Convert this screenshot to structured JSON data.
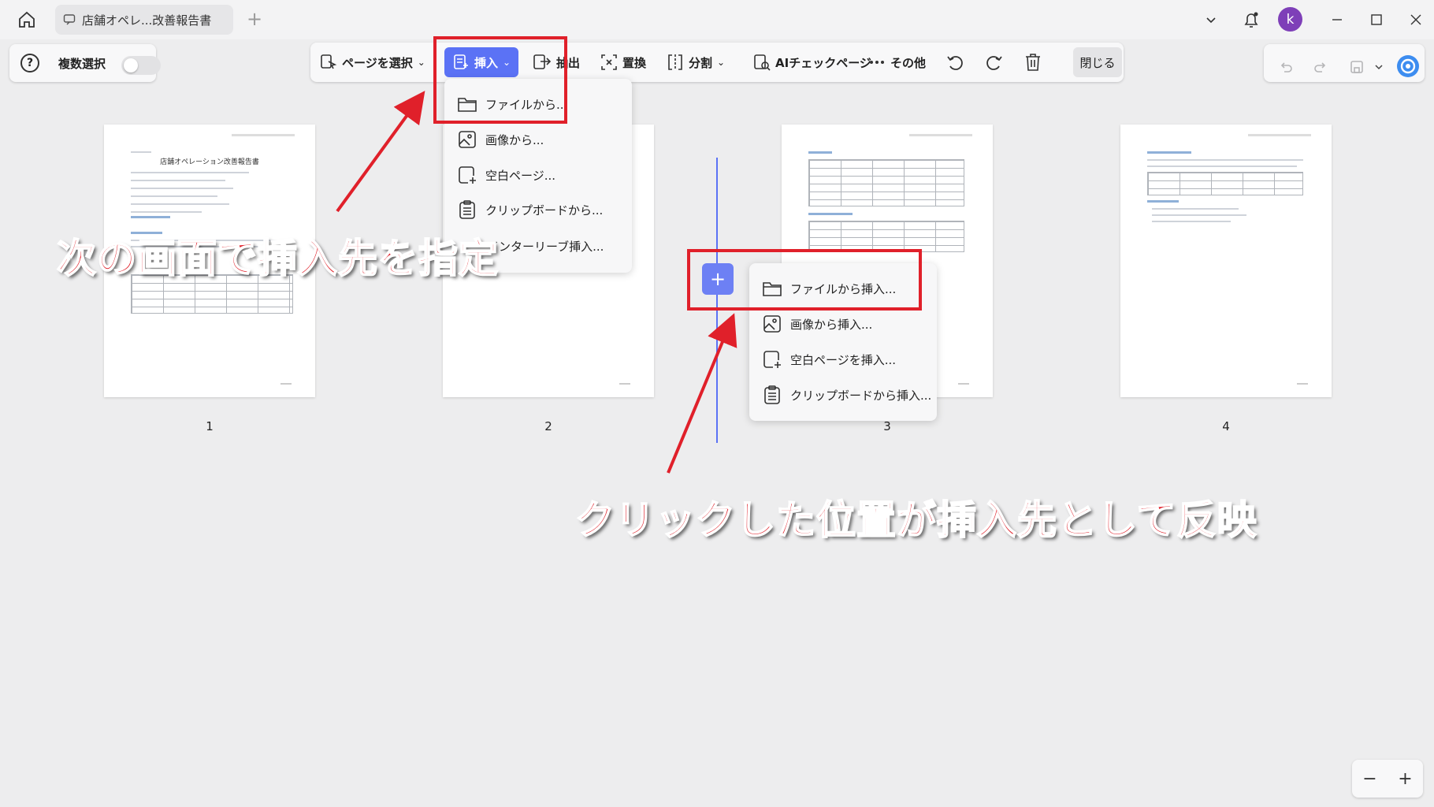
{
  "tab": {
    "title": "店舗オペレ...改善報告書"
  },
  "user": {
    "initial": "k"
  },
  "toolbar": {
    "multi_select_label": "複数選択",
    "select_page": "ページを選択",
    "insert": "挿入",
    "extract": "抽出",
    "replace": "置換",
    "split": "分割",
    "ai_check": "AIチェックページ",
    "more": "その他",
    "close": "閉じる"
  },
  "insert_menu": {
    "items": [
      "ファイルから...",
      "画像から...",
      "空白ページ...",
      "クリップボードから...",
      "インターリーブ挿入..."
    ]
  },
  "context_menu": {
    "items": [
      "ファイルから挿入...",
      "画像から挿入...",
      "空白ページを挿入...",
      "クリップボードから挿入..."
    ]
  },
  "pages": {
    "numbers": [
      "1",
      "2",
      "3",
      "4"
    ],
    "page1_title": "店舗オペレーション改善報告書"
  },
  "annotations": {
    "top": "次の画面で挿入先を指定",
    "bottom": "クリックした位置が挿入先として反映"
  },
  "colors": {
    "accent": "#5b72f5",
    "annotation": "#e0202a",
    "avatar": "#7e3fb8"
  }
}
